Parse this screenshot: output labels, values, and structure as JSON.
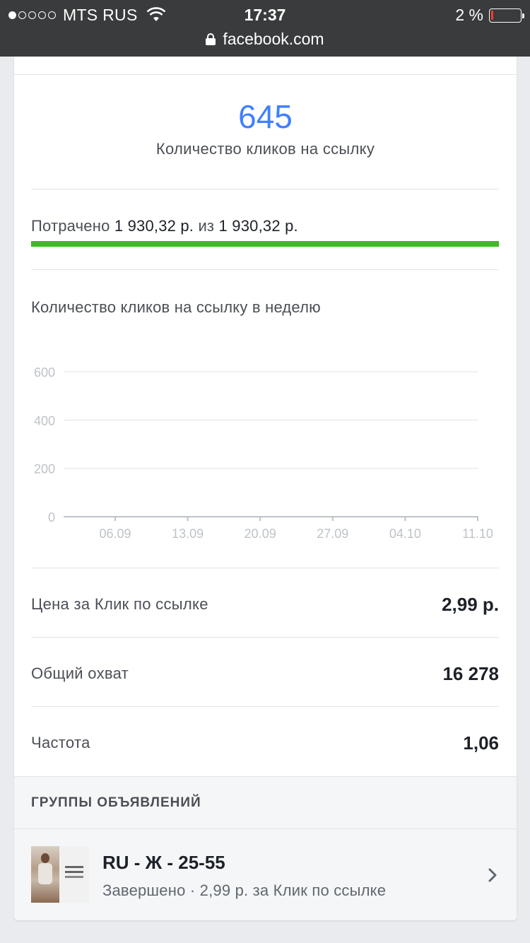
{
  "status_bar": {
    "carrier": "MTS RUS",
    "time": "17:37",
    "battery": "2 %",
    "url": "facebook.com"
  },
  "summary": {
    "result_value": "645",
    "result_label": "Количество кликов на ссылку"
  },
  "budget": {
    "spent_prefix": "Потрачено",
    "spent_amount": "1 930,32 р.",
    "of_word": "из",
    "total_amount": "1 930,32 р.",
    "progress_fraction": 1.0
  },
  "chart_data": {
    "type": "line",
    "title": "Количество кликов на ссылку в неделю",
    "categories": [
      "06.09",
      "13.09",
      "20.09",
      "27.09",
      "04.10",
      "11.10"
    ],
    "y_ticks": [
      0,
      200,
      400,
      600
    ],
    "ylim": [
      0,
      600
    ],
    "grid": true,
    "series": []
  },
  "metrics": [
    {
      "label": "Цена за Клик по ссылке",
      "value": "2,99 р."
    },
    {
      "label": "Общий охват",
      "value": "16 278"
    },
    {
      "label": "Частота",
      "value": "1,06"
    }
  ],
  "ad_groups": {
    "section_title": "ГРУППЫ ОБЪЯВЛЕНИЙ",
    "items": [
      {
        "name": "RU - Ж - 25-55",
        "status": "Завершено · 2,99 р. за Клик по ссылке"
      }
    ]
  },
  "colors": {
    "accent": "#4080ff",
    "progress": "#42b72a",
    "status_bar": "#3a3b3c"
  }
}
